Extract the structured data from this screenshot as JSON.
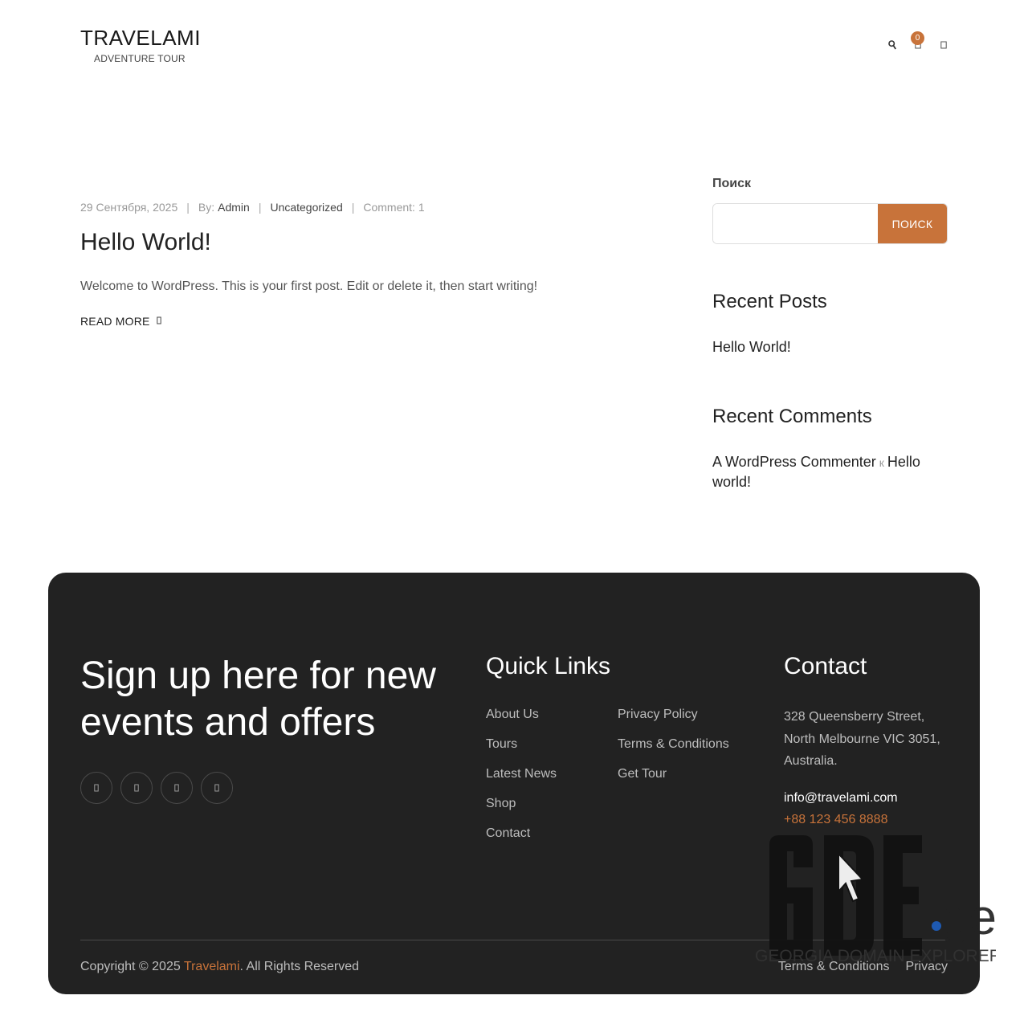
{
  "header": {
    "logo_title": "TRAVELAMI",
    "logo_tagline": "ADVENTURE TOUR",
    "cart_count": "0",
    "icons": [
      "search-icon",
      "cart-icon",
      "user-icon"
    ]
  },
  "post": {
    "date": "29 Сентября, 2025",
    "by_label": "By:",
    "author": "Admin",
    "category": "Uncategorized",
    "comments": "Comment: 1",
    "title": "Hello World!",
    "excerpt": "Welcome to WordPress. This is your first post. Edit or delete it, then start writing!",
    "read_more": "READ MORE"
  },
  "sidebar": {
    "search_label": "Поиск",
    "search_placeholder": "",
    "search_button": "ПОИСК",
    "recent_posts_title": "Recent Posts",
    "recent_posts": [
      "Hello World!"
    ],
    "recent_comments_title": "Recent Comments",
    "recent_comment": {
      "author": "A WordPress Commenter",
      "on": "к",
      "post": "Hello world!"
    }
  },
  "footer": {
    "signup_text": "Sign up here for new events and offers",
    "socials": [
      "facebook-icon",
      "twitter-icon",
      "instagram-icon",
      "linkedin-icon"
    ],
    "quick_links_title": "Quick Links",
    "quick_links_col1": [
      "About Us",
      "Tours",
      "Latest News",
      "Shop",
      "Contact"
    ],
    "quick_links_col2": [
      "Privacy Policy",
      "Terms & Conditions",
      "Get Tour"
    ],
    "contact_title": "Contact",
    "address": "328 Queensberry Street, North Melbourne VIC 3051, Australia.",
    "email": "info@travelami.com",
    "phone": "+88 123 456 8888",
    "copyright_prefix": "Copyright © 2025 ",
    "copyright_brand": "Travelami",
    "copyright_suffix": ". All Rights Reserved",
    "bottom_links": [
      "Terms & Conditions",
      "Privacy"
    ]
  },
  "watermark": {
    "brand": "GDE",
    "tld": ".ge",
    "tagline": "GEORGIA DOMAIN EXPLORER"
  },
  "colors": {
    "accent": "#c8733a",
    "footer_bg": "#222222",
    "watermark_dot": "#1e5fbf"
  }
}
